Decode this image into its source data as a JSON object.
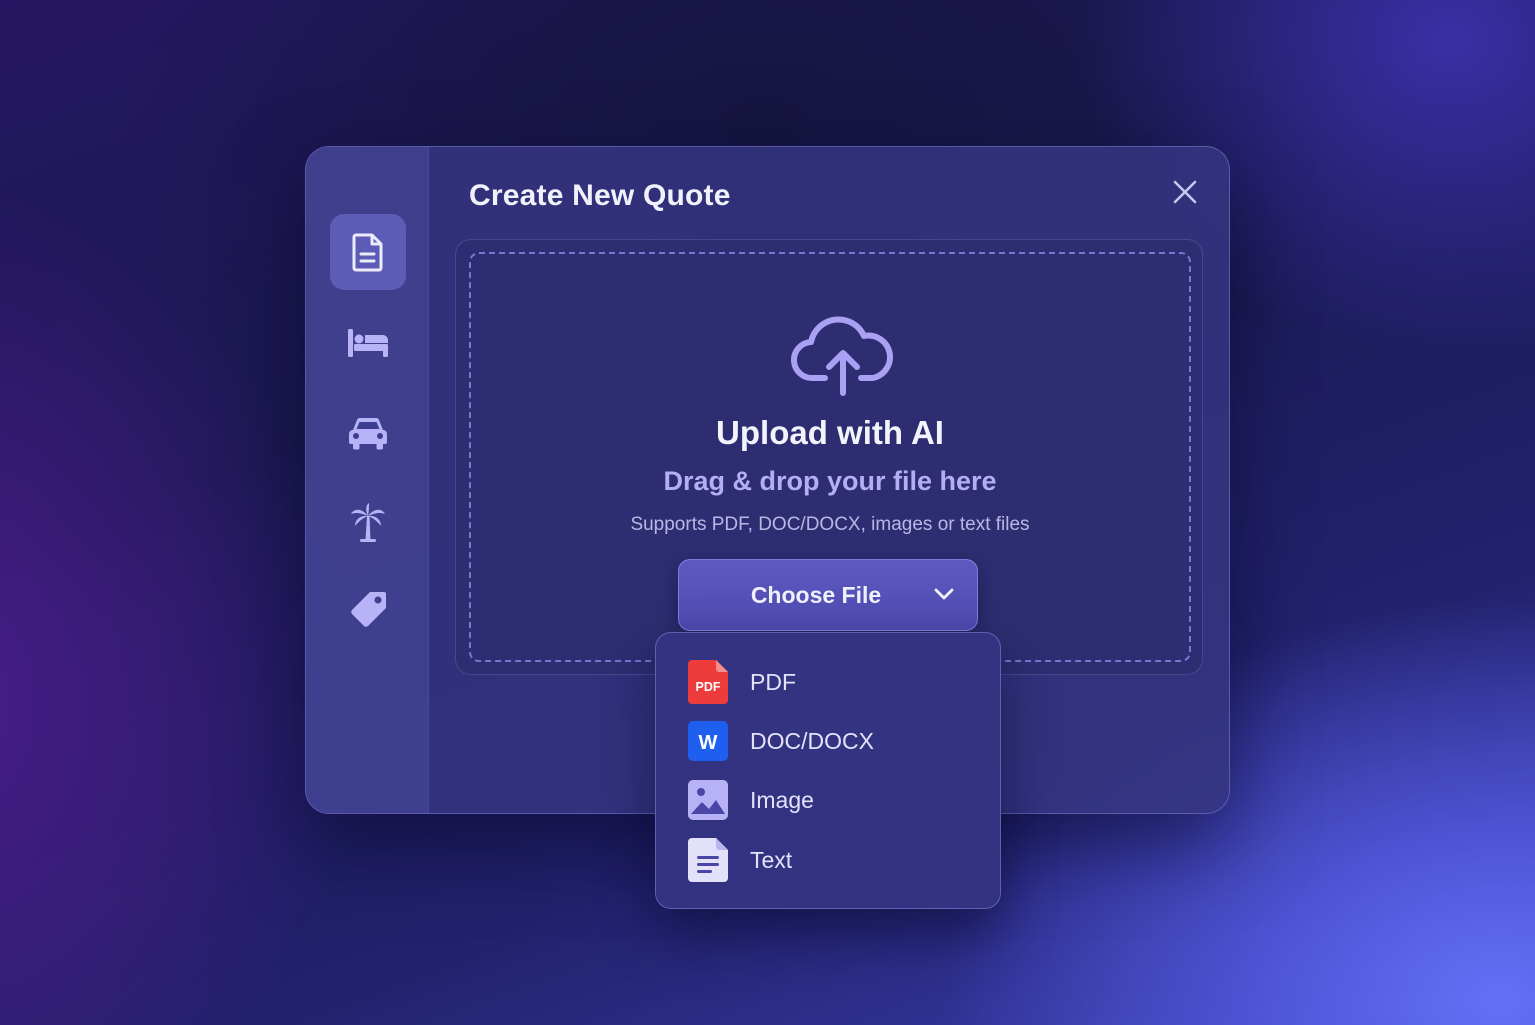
{
  "dialog": {
    "title": "Create New Quote",
    "close_icon": "close-icon"
  },
  "sidebar": {
    "items": [
      {
        "icon": "document-icon",
        "active": true
      },
      {
        "icon": "bed-icon",
        "active": false
      },
      {
        "icon": "car-icon",
        "active": false
      },
      {
        "icon": "palm-tree-icon",
        "active": false
      },
      {
        "icon": "tag-icon",
        "active": false
      }
    ]
  },
  "upload": {
    "icon": "cloud-upload-icon",
    "title": "Upload with AI",
    "subtitle": "Drag & drop your file here",
    "supports": "Supports PDF, DOC/DOCX, images or text files"
  },
  "choose_file": {
    "label": "Choose File",
    "icon": "chevron-down-icon"
  },
  "menu": {
    "items": [
      {
        "label": "PDF",
        "icon": "pdf-file-icon",
        "badge": "PDF",
        "color": "#ee3b3b"
      },
      {
        "label": "DOC/DOCX",
        "icon": "word-file-icon",
        "badge": "W",
        "color": "#1f5ff0"
      },
      {
        "label": "Image",
        "icon": "image-file-icon",
        "color": "#b7b2f5"
      },
      {
        "label": "Text",
        "icon": "text-file-icon",
        "color": "#e3e1fa"
      }
    ]
  },
  "colors": {
    "accent": "#5c5cb6",
    "dialog_bg": "#343480",
    "text_secondary": "#b4aef6"
  }
}
